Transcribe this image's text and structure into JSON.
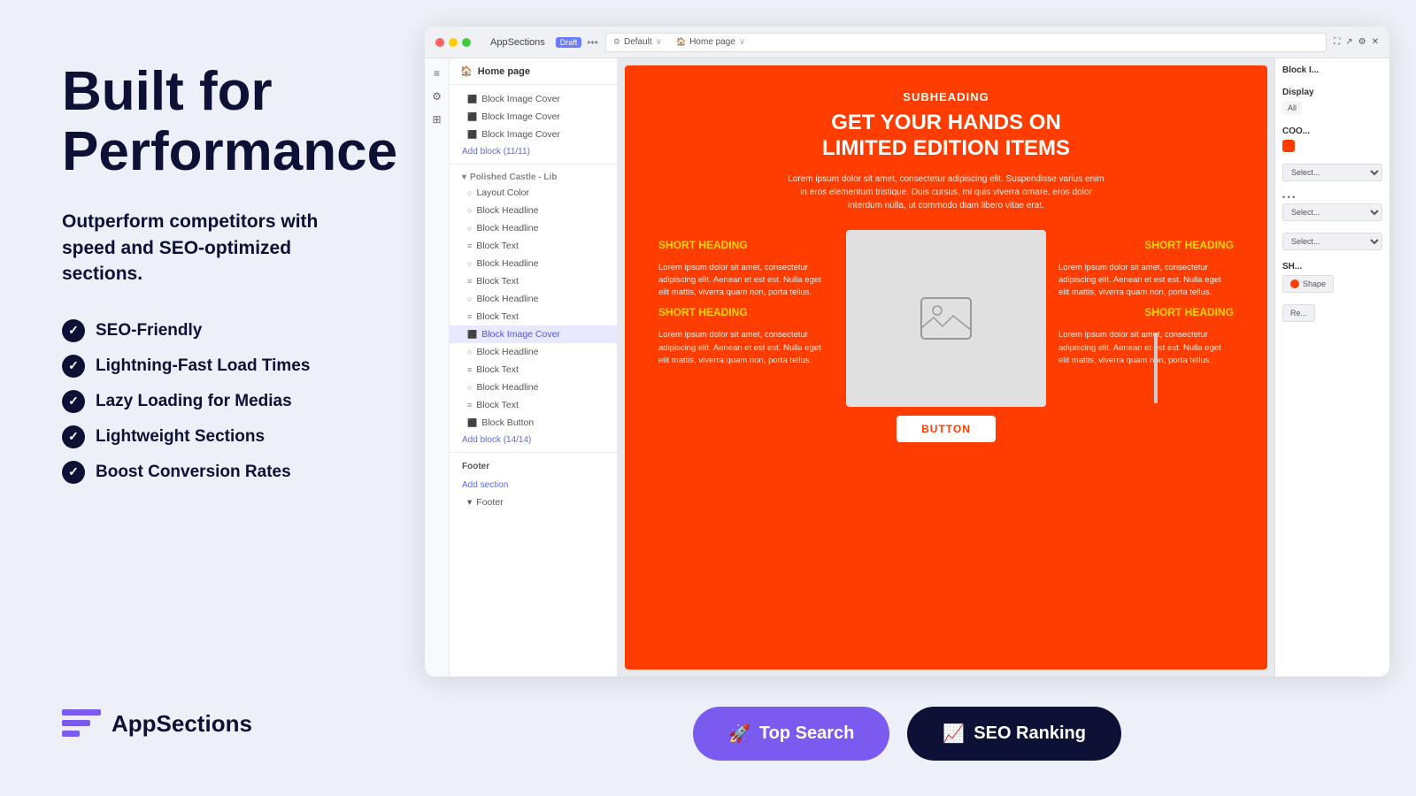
{
  "page": {
    "background_color": "#eef0f8"
  },
  "left_panel": {
    "title_line1": "Built for",
    "title_line2": "Performance",
    "subtitle": "Outperform competitors with speed and SEO-optimized sections.",
    "features": [
      "SEO-Friendly",
      "Lightning-Fast Load Times",
      "Lazy Loading for Medias",
      "Lightweight Sections",
      "Boost Conversion Rates"
    ],
    "logo_text_regular": "App",
    "logo_text_bold": "Sections"
  },
  "browser": {
    "tab_label": "AppSections",
    "draft_badge": "Draft",
    "default_label": "Default",
    "home_page_label": "Home page"
  },
  "sidebar": {
    "home_page_label": "Home page",
    "items": [
      "Block Image Cover",
      "Block Image Cover",
      "Block Image Cover",
      "Add block (11/11)",
      "Polished Castle - Lib",
      "Layout Color",
      "Block Headline",
      "Block Headline",
      "Block Text",
      "Block Headline",
      "Block Text",
      "Block Headline",
      "Block Text",
      "Block Image Cover",
      "Block Headline",
      "Block Text",
      "Block Headline",
      "Block Text",
      "Block Button"
    ],
    "add_block_label": "Add block (14/14)",
    "add_section_label": "Add section",
    "footer_label": "Footer"
  },
  "canvas": {
    "subheading": "SUBHEADING",
    "heading_line1": "GET YOUR HANDS ON",
    "heading_line2": "LIMITED EDITION ITEMS",
    "body_text": "Lorem ipsum dolor sit amet, consectetur adipiscing elit. Suspendisse varius enim in eros elementum tristique. Duis cursus, mi quis viverra ornare, eros dolor interdum nulla, ut commodo diam libero vitae erat.",
    "short_heading_1": "SHORT HEADING",
    "short_heading_2": "SHORT HEADING",
    "short_heading_3": "SHORT HEADING",
    "short_heading_4": "SHORT HEADING",
    "item_text": "Lorem ipsum dolor sit amet, consectetur adipiscing elit. Aenean et est est. Nulla eget elit mattis, viverra quam non, porta tellus.",
    "button_label": "BUTTON",
    "bg_color": "#ff3d00"
  },
  "properties_panel": {
    "title": "Block I...",
    "display_label": "Display",
    "display_value": "All",
    "color_label": "COO...",
    "select_label1": "Select...",
    "select_label2": "Select...",
    "select_label3": "Select...",
    "shape_label": "SH...",
    "shape_value": "Shape",
    "reset_label": "Re..."
  },
  "buttons": {
    "top_search_label": "Top Search",
    "top_search_icon": "🚀",
    "seo_ranking_label": "SEO Ranking",
    "seo_ranking_icon": "📈"
  }
}
